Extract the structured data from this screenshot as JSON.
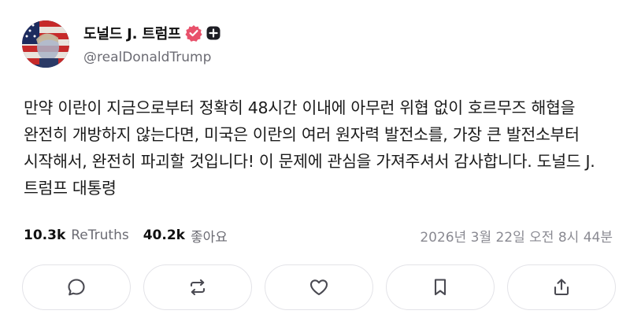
{
  "author": {
    "display_name": "도널드 J. 트럼프",
    "handle": "@realDonaldTrump",
    "avatar_icon": "avatar-portrait-flag",
    "verified_icon": "verified-badge-icon",
    "plus_icon": "plus-box-icon"
  },
  "post": {
    "text": "만약 이란이 지금으로부터 정확히 48시간 이내에 아무런 위협 없이 호르무즈 해협을 완전히 개방하지 않는다면, 미국은 이란의 여러 원자력 발전소를, 가장 큰 발전소부터 시작해서, 완전히 파괴할 것입니다! 이 문제에 관심을 가져주셔서 감사합니다. 도널드 J. 트럼프 대통령"
  },
  "stats": {
    "retruths_count": "10.3k",
    "retruths_label": "ReTruths",
    "likes_count": "40.2k",
    "likes_label": "좋아요",
    "timestamp": "2026년 3월 22일 오전 8시 44분"
  },
  "actions": [
    {
      "name": "reply",
      "icon": "comment-icon"
    },
    {
      "name": "retruth",
      "icon": "repost-icon"
    },
    {
      "name": "like",
      "icon": "heart-icon"
    },
    {
      "name": "bookmark",
      "icon": "bookmark-icon"
    },
    {
      "name": "share",
      "icon": "share-icon"
    }
  ],
  "colors": {
    "verified": "#e8516b",
    "muted_text": "#6b6b73",
    "border": "#e3e3e8",
    "icon": "#4a4a52"
  }
}
